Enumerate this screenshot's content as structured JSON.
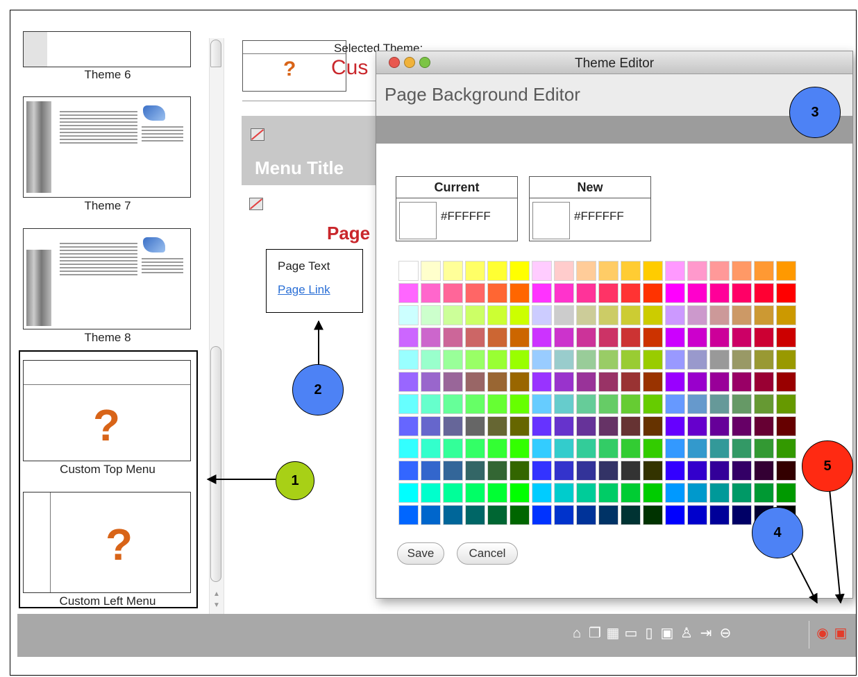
{
  "themes": [
    {
      "caption": "Theme 6"
    },
    {
      "caption": "Theme 7"
    },
    {
      "caption": "Theme 8"
    }
  ],
  "custom_themes": [
    {
      "caption": "Custom Top Menu",
      "glyph": "?"
    },
    {
      "caption": "Custom Left Menu",
      "glyph": "?"
    }
  ],
  "selected": {
    "label": "Selected Theme:",
    "name": "Cus",
    "glyph": "?"
  },
  "preview": {
    "menu_title": "Menu Title",
    "page_title": "Page",
    "page_text": "Page Text",
    "page_link": "Page Link"
  },
  "dialog": {
    "window_title": "Theme Editor",
    "subtitle": "Page Background Editor",
    "current": {
      "label": "Current",
      "hex": "#FFFFFF"
    },
    "new": {
      "label": "New",
      "hex": "#FFFFFF"
    },
    "save_label": "Save",
    "cancel_label": "Cancel"
  },
  "callouts": [
    "1",
    "2",
    "3",
    "4",
    "5"
  ],
  "toolbar_icons": [
    "home-icon",
    "pages-icon",
    "layout-grid-icon",
    "page-icon",
    "page-down-icon",
    "page-box-icon",
    "user-icon",
    "exit-icon",
    "link-icon",
    "preview-eye-icon",
    "save-disk-icon"
  ],
  "colors": {
    "accent_red": "#c9262b",
    "callout_blue": "#4d82f5",
    "callout_green": "#a8d016",
    "callout_red": "#ff2a12",
    "toolbar": "#a8a8a8"
  },
  "palette_rows": [
    [
      "#FFFFFF",
      "#FFFFCC",
      "#FFFF99",
      "#FFFF66",
      "#FFFF33",
      "#FFFF00",
      "#FFCCFF",
      "#FFCCCC",
      "#FFCC99",
      "#FFCC66",
      "#FFCC33",
      "#FFCC00",
      "#FF99FF",
      "#FF99CC",
      "#FF9999",
      "#FF9966",
      "#FF9933",
      "#FF9900"
    ],
    [
      "#FF66FF",
      "#FF66CC",
      "#FF6699",
      "#FF6666",
      "#FF6633",
      "#FF6600",
      "#FF33FF",
      "#FF33CC",
      "#FF3399",
      "#FF3366",
      "#FF3333",
      "#FF3300",
      "#FF00FF",
      "#FF00CC",
      "#FF0099",
      "#FF0066",
      "#FF0033",
      "#FF0000"
    ],
    [
      "#CCFFFF",
      "#CCFFCC",
      "#CCFF99",
      "#CCFF66",
      "#CCFF33",
      "#CCFF00",
      "#CCCCFF",
      "#CCCCCC",
      "#CCCC99",
      "#CCCC66",
      "#CCCC33",
      "#CCCC00",
      "#CC99FF",
      "#CC99CC",
      "#CC9999",
      "#CC9966",
      "#CC9933",
      "#CC9900"
    ],
    [
      "#CC66FF",
      "#CC66CC",
      "#CC6699",
      "#CC6666",
      "#CC6633",
      "#CC6600",
      "#CC33FF",
      "#CC33CC",
      "#CC3399",
      "#CC3366",
      "#CC3333",
      "#CC3300",
      "#CC00FF",
      "#CC00CC",
      "#CC0099",
      "#CC0066",
      "#CC0033",
      "#CC0000"
    ],
    [
      "#99FFFF",
      "#99FFCC",
      "#99FF99",
      "#99FF66",
      "#99FF33",
      "#99FF00",
      "#99CCFF",
      "#99CCCC",
      "#99CC99",
      "#99CC66",
      "#99CC33",
      "#99CC00",
      "#9999FF",
      "#9999CC",
      "#999999",
      "#999966",
      "#999933",
      "#999900"
    ],
    [
      "#9966FF",
      "#9966CC",
      "#996699",
      "#996666",
      "#996633",
      "#996600",
      "#9933FF",
      "#9933CC",
      "#993399",
      "#993366",
      "#993333",
      "#993300",
      "#9900FF",
      "#9900CC",
      "#990099",
      "#990066",
      "#990033",
      "#990000"
    ],
    [
      "#66FFFF",
      "#66FFCC",
      "#66FF99",
      "#66FF66",
      "#66FF33",
      "#66FF00",
      "#66CCFF",
      "#66CCCC",
      "#66CC99",
      "#66CC66",
      "#66CC33",
      "#66CC00",
      "#6699FF",
      "#6699CC",
      "#669999",
      "#669966",
      "#669933",
      "#669900"
    ],
    [
      "#6666FF",
      "#6666CC",
      "#666699",
      "#666666",
      "#666633",
      "#666600",
      "#6633FF",
      "#6633CC",
      "#663399",
      "#663366",
      "#663333",
      "#663300",
      "#6600FF",
      "#6600CC",
      "#660099",
      "#660066",
      "#660033",
      "#660000"
    ],
    [
      "#33FFFF",
      "#33FFCC",
      "#33FF99",
      "#33FF66",
      "#33FF33",
      "#33FF00",
      "#33CCFF",
      "#33CCCC",
      "#33CC99",
      "#33CC66",
      "#33CC33",
      "#33CC00",
      "#3399FF",
      "#3399CC",
      "#339999",
      "#339966",
      "#339933",
      "#339900"
    ],
    [
      "#3366FF",
      "#3366CC",
      "#336699",
      "#336666",
      "#336633",
      "#336600",
      "#3333FF",
      "#3333CC",
      "#333399",
      "#333366",
      "#333333",
      "#333300",
      "#3300FF",
      "#3300CC",
      "#330099",
      "#330066",
      "#330033",
      "#330000"
    ],
    [
      "#00FFFF",
      "#00FFCC",
      "#00FF99",
      "#00FF66",
      "#00FF33",
      "#00FF00",
      "#00CCFF",
      "#00CCCC",
      "#00CC99",
      "#00CC66",
      "#00CC33",
      "#00CC00",
      "#0099FF",
      "#0099CC",
      "#009999",
      "#009966",
      "#009933",
      "#009900"
    ],
    [
      "#0066FF",
      "#0066CC",
      "#006699",
      "#006666",
      "#006633",
      "#006600",
      "#0033FF",
      "#0033CC",
      "#003399",
      "#003366",
      "#003333",
      "#003300",
      "#0000FF",
      "#0000CC",
      "#000099",
      "#000066",
      "#000033",
      "#000000"
    ]
  ]
}
